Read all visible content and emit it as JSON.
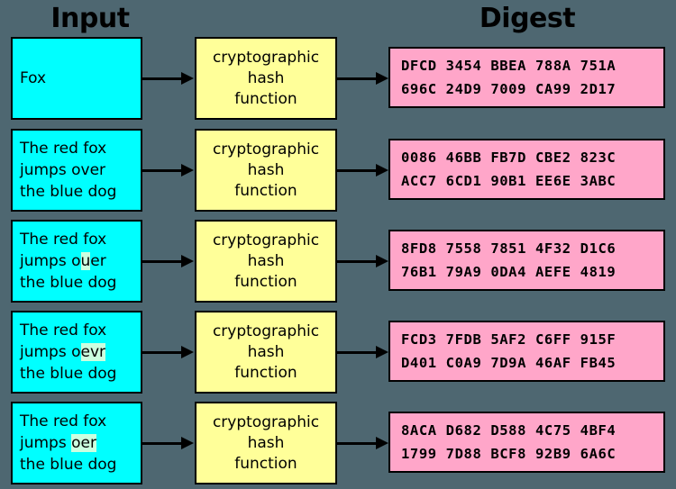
{
  "headers": {
    "input": "Input",
    "digest": "Digest"
  },
  "colors": {
    "background": "#4e6771",
    "input_box": "#00FFFF",
    "function_box": "#FFFF99",
    "digest_box": "#FFA6C9",
    "highlight": "#CCFFE0",
    "border": "#000000",
    "text": "#000000"
  },
  "function_label": {
    "line1": "cryptographic",
    "line2": "hash",
    "line3": "function"
  },
  "rows": [
    {
      "input": {
        "lines": [
          [
            {
              "text": "Fox",
              "highlight": false
            }
          ]
        ]
      },
      "digest": {
        "line1": "DFCD 3454 BBEA 788A 751A",
        "line2": "696C 24D9 7009 CA99 2D17"
      }
    },
    {
      "input": {
        "lines": [
          [
            {
              "text": "The red fox",
              "highlight": false
            }
          ],
          [
            {
              "text": "jumps over",
              "highlight": false
            }
          ],
          [
            {
              "text": "the blue dog",
              "highlight": false
            }
          ]
        ]
      },
      "digest": {
        "line1": "0086 46BB FB7D CBE2 823C",
        "line2": "ACC7 6CD1 90B1 EE6E 3ABC"
      }
    },
    {
      "input": {
        "lines": [
          [
            {
              "text": "The red fox",
              "highlight": false
            }
          ],
          [
            {
              "text": "jumps o",
              "highlight": false
            },
            {
              "text": "u",
              "highlight": true
            },
            {
              "text": "er",
              "highlight": false
            }
          ],
          [
            {
              "text": "the blue dog",
              "highlight": false
            }
          ]
        ]
      },
      "digest": {
        "line1": "8FD8 7558 7851 4F32 D1C6",
        "line2": "76B1 79A9 0DA4 AEFE 4819"
      }
    },
    {
      "input": {
        "lines": [
          [
            {
              "text": "The red fox",
              "highlight": false
            }
          ],
          [
            {
              "text": "jumps o",
              "highlight": false
            },
            {
              "text": "evr",
              "highlight": true
            }
          ],
          [
            {
              "text": "the blue dog",
              "highlight": false
            }
          ]
        ]
      },
      "digest": {
        "line1": "FCD3 7FDB 5AF2 C6FF 915F",
        "line2": "D401 C0A9 7D9A 46AF FB45"
      }
    },
    {
      "input": {
        "lines": [
          [
            {
              "text": "The red fox",
              "highlight": false
            }
          ],
          [
            {
              "text": "jumps ",
              "highlight": false
            },
            {
              "text": "oer",
              "highlight": true
            }
          ],
          [
            {
              "text": "the blue dog",
              "highlight": false
            }
          ]
        ]
      },
      "digest": {
        "line1": "8ACA D682 D588 4C75 4BF4",
        "line2": "1799 7D88 BCF8 92B9 6A6C"
      }
    }
  ]
}
